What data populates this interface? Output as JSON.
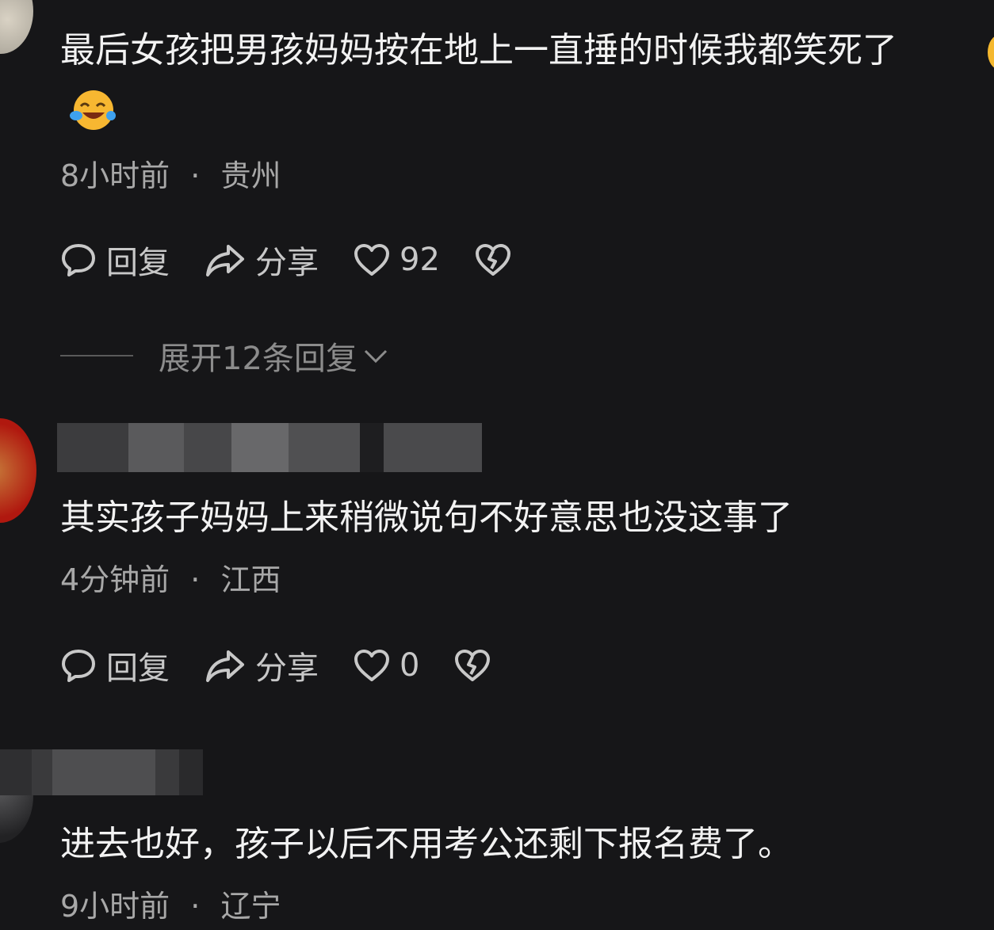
{
  "comments": [
    {
      "text": "最后女孩把男孩妈妈按在地上一直捶的时候我都笑死了",
      "emoji": "laughing-crying-emoji",
      "time": "8小时前",
      "location": "贵州",
      "reply_label": "回复",
      "share_label": "分享",
      "likes": "92",
      "expand_label": "展开12条回复"
    },
    {
      "text": "其实孩子妈妈上来稍微说句不好意思也没这事了",
      "time": "4分钟前",
      "location": "江西",
      "reply_label": "回复",
      "share_label": "分享",
      "likes": "0"
    },
    {
      "text": "进去也好，孩子以后不用考公还剩下报名费了。",
      "time": "9小时前",
      "location": "辽宁"
    }
  ],
  "separator": "·",
  "colors": {
    "background": "#161618",
    "text": "#f2f2f2",
    "meta": "#a8a8a8",
    "icon": "#c8c8c8"
  }
}
